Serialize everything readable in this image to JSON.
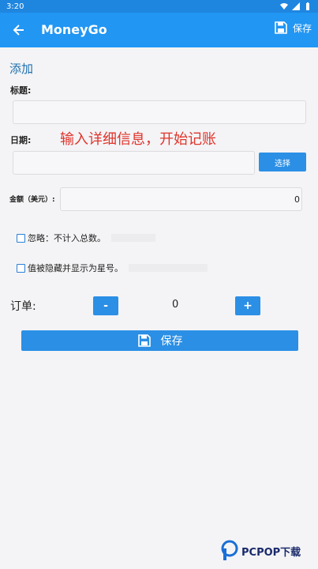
{
  "status_bar": {
    "time": "3:20"
  },
  "app_bar": {
    "title": "MoneyGo",
    "save_label": "保存"
  },
  "form": {
    "section_title": "添加",
    "title_label": "标题:",
    "title_value": "",
    "date_label": "日期:",
    "date_value": "",
    "select_button": "选择",
    "amount_label": "金额（美元）:",
    "amount_value": "0",
    "ignore_label": "忽略：不计入总数。",
    "hidden_label": "值被隐藏并显示为星号。",
    "order_label": "订单:",
    "order_minus": "-",
    "order_value": "0",
    "order_plus": "+",
    "save_button": "保存"
  },
  "overlay_caption": "输入详细信息，开始记账",
  "watermark": {
    "text": "PCPOP下载"
  },
  "colors": {
    "app_bar": "#2196f3",
    "accent": "#2b8fe5",
    "caption": "#e0342b"
  }
}
